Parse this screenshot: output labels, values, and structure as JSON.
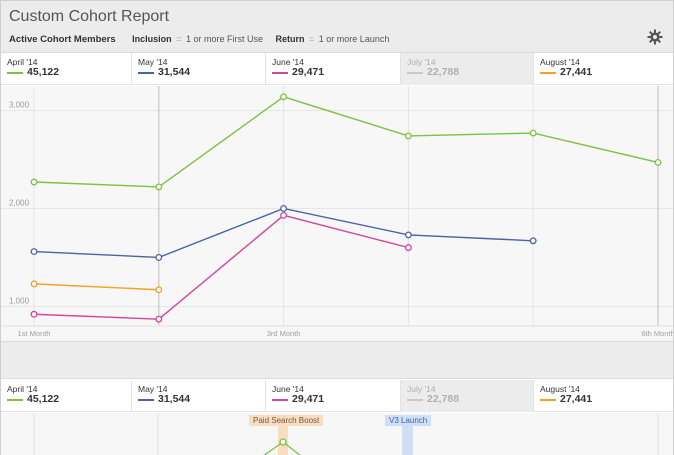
{
  "report": {
    "title": "Custom Cohort Report",
    "criteria_label": "Active Cohort Members",
    "inclusion_label": "Inclusion",
    "inclusion_value": "1 or more First Use",
    "return_label": "Return",
    "return_value": "1 or more Launch",
    "separator": "=",
    "settings_icon": "gear-icon"
  },
  "cohorts": [
    {
      "name": "April '14",
      "value": "45,122",
      "color": "#7dc241",
      "dimmed": false
    },
    {
      "name": "May '14",
      "value": "31,544",
      "color": "#4a63a3",
      "dimmed": false
    },
    {
      "name": "June '14",
      "value": "29,471",
      "color": "#d4449b",
      "dimmed": false
    },
    {
      "name": "July '14",
      "value": "22,788",
      "color": "#c8c8c8",
      "dimmed": true
    },
    {
      "name": "August '14",
      "value": "27,441",
      "color": "#f5a11f",
      "dimmed": false
    }
  ],
  "chart_data": {
    "type": "line",
    "x": [
      1,
      2,
      3,
      4,
      5,
      6
    ],
    "xtick_labels": [
      "1st Month",
      "",
      "3rd Month",
      "",
      "",
      "6th Month"
    ],
    "ylim": [
      800,
      3250
    ],
    "yticks": [
      1000,
      2000,
      3000
    ],
    "ytick_labels": [
      "1,000",
      "2,000",
      "3,000"
    ],
    "grid": true,
    "series": [
      {
        "name": "April '14",
        "color": "#7dc241",
        "values": [
          2270,
          2220,
          3140,
          2740,
          2770,
          2470
        ]
      },
      {
        "name": "May '14",
        "color": "#4a63a3",
        "values": [
          1560,
          1500,
          2000,
          1730,
          1670
        ]
      },
      {
        "name": "June '14",
        "color": "#d4449b",
        "values": [
          920,
          870,
          1930,
          1600
        ]
      },
      {
        "name": "August '14",
        "color": "#f5a11f",
        "values": [
          1230,
          1170
        ]
      }
    ]
  },
  "markers": [
    {
      "label": "Paid Search Boost",
      "color": "#f8ddc0",
      "text_color": "#7a5a3a"
    },
    {
      "label": "V3 Launch",
      "color": "#cfe0f6",
      "text_color": "#3f67a8"
    }
  ],
  "lower_chart": {
    "visible_point": {
      "series": "April '14",
      "x": 3
    }
  }
}
